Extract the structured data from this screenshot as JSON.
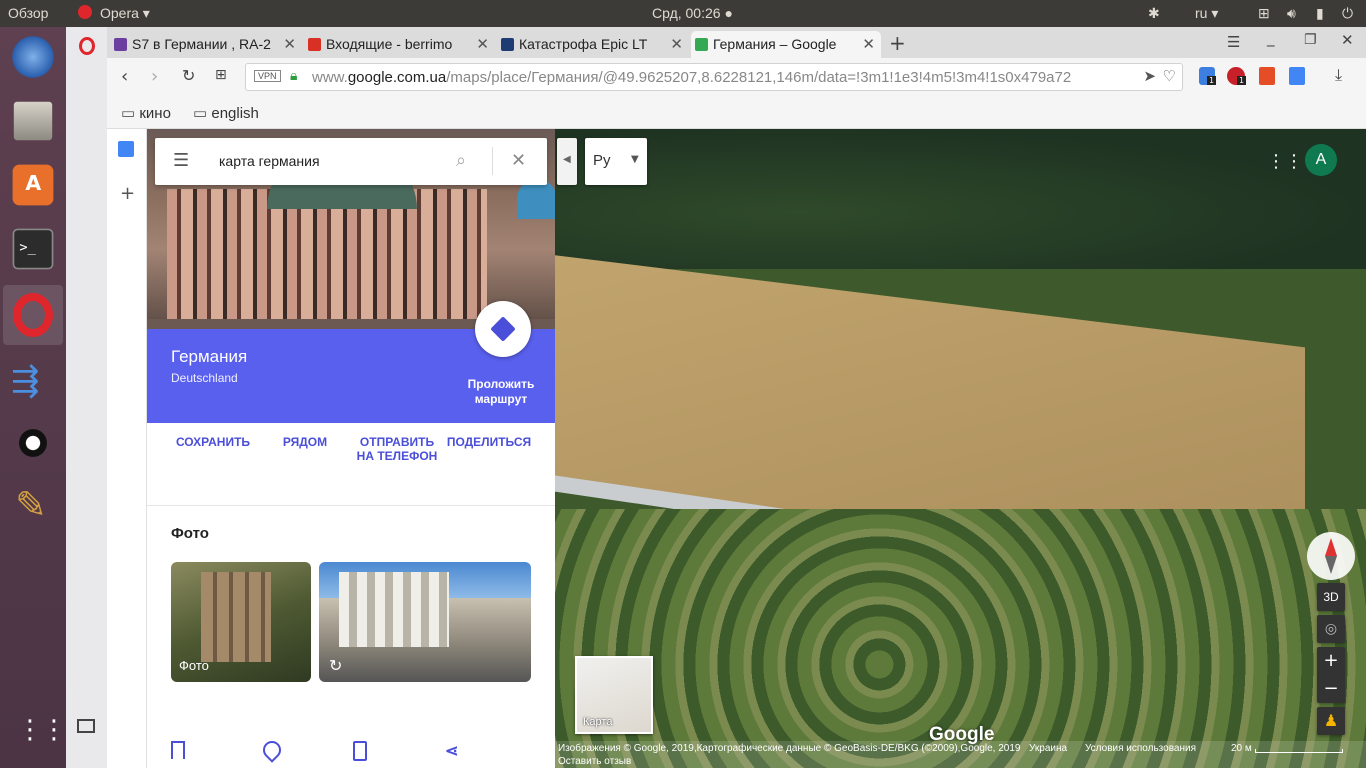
{
  "system": {
    "overview": "Обзор",
    "app_menu": "Opera",
    "clock": "Срд, 00:26",
    "lang": "ru"
  },
  "tabs": [
    {
      "title": "S7 в Германии , RA-2",
      "favicon_color": "#6b3fa0"
    },
    {
      "title": "Входящие - berrimo",
      "favicon_color": "#d93025"
    },
    {
      "title": "Катастрофа Epic LT",
      "favicon_color": "#1f3b73"
    },
    {
      "title": "Германия – Google",
      "favicon_color": "#34a853"
    }
  ],
  "address": {
    "vpn": "VPN",
    "prefix": "www.",
    "domain": "google.com.ua",
    "path": "/maps/place/Германия/@49.9625207,8.6228121,146m/data=!3m1!1e3!4m5!3m4!1s0x479a72"
  },
  "bookmarks": [
    "кино",
    "english"
  ],
  "search": {
    "value": "карта германия"
  },
  "place": {
    "name": "Германия",
    "native_name": "Deutschland",
    "route_label": "Проложить маршрут"
  },
  "actions": [
    {
      "label": "СОХРАНИТЬ",
      "icon": "bookmark-icon"
    },
    {
      "label": "РЯДОМ",
      "icon": "nearby-icon"
    },
    {
      "label": "ОТПРАВИТЬ НА ТЕЛЕФОН",
      "icon": "send-to-phone-icon"
    },
    {
      "label": "ПОДЕЛИТЬСЯ",
      "icon": "share-icon"
    }
  ],
  "photos": {
    "heading": "Фото",
    "thumb1_label": "Фото"
  },
  "map": {
    "lang_button": "Ру",
    "avatar": "A",
    "mode_3d": "3D",
    "minimap_label": "Карта",
    "logo": "Google",
    "footer": {
      "imagery": "Изображения © Google, 2019,Картографические данные © GeoBasis-DE/BKG (©2009),Google, 2019",
      "country": "Украина",
      "terms": "Условия использования",
      "scale": "20 м",
      "feedback": "Оставить отзыв"
    }
  },
  "extensions": {
    "badge1": "1",
    "badge2": "1"
  }
}
